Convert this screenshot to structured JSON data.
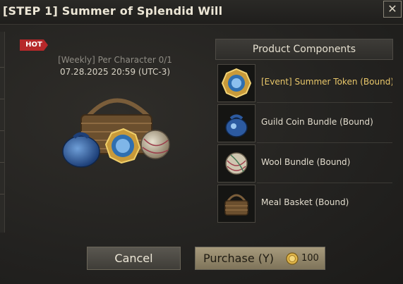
{
  "window": {
    "title": "[STEP 1] Summer of Splendid Will",
    "close_label": "✕"
  },
  "product": {
    "badge": "HOT",
    "limit_text": "[Weekly] Per Character 0/1",
    "date_text": "07.28.2025 20:59 (UTC-3)",
    "image_icon": "summer-package-icon"
  },
  "components": {
    "header": "Product Components",
    "items": [
      {
        "label": "[Event] Summer Token (Bound)",
        "icon": "summer-token-icon"
      },
      {
        "label": "Guild Coin Bundle (Bound)",
        "icon": "guild-coin-bundle-icon"
      },
      {
        "label": "Wool Bundle (Bound)",
        "icon": "wool-bundle-icon"
      },
      {
        "label": "Meal Basket (Bound)",
        "icon": "meal-basket-icon"
      }
    ]
  },
  "buttons": {
    "cancel_label": "Cancel",
    "purchase_label": "Purchase (Y)",
    "price": "100",
    "price_icon": "gold-coin-icon"
  },
  "colors": {
    "hot_badge": "#b6282a",
    "highlight_text": "#e9c76a",
    "purchase_button": "#9a8f72"
  }
}
